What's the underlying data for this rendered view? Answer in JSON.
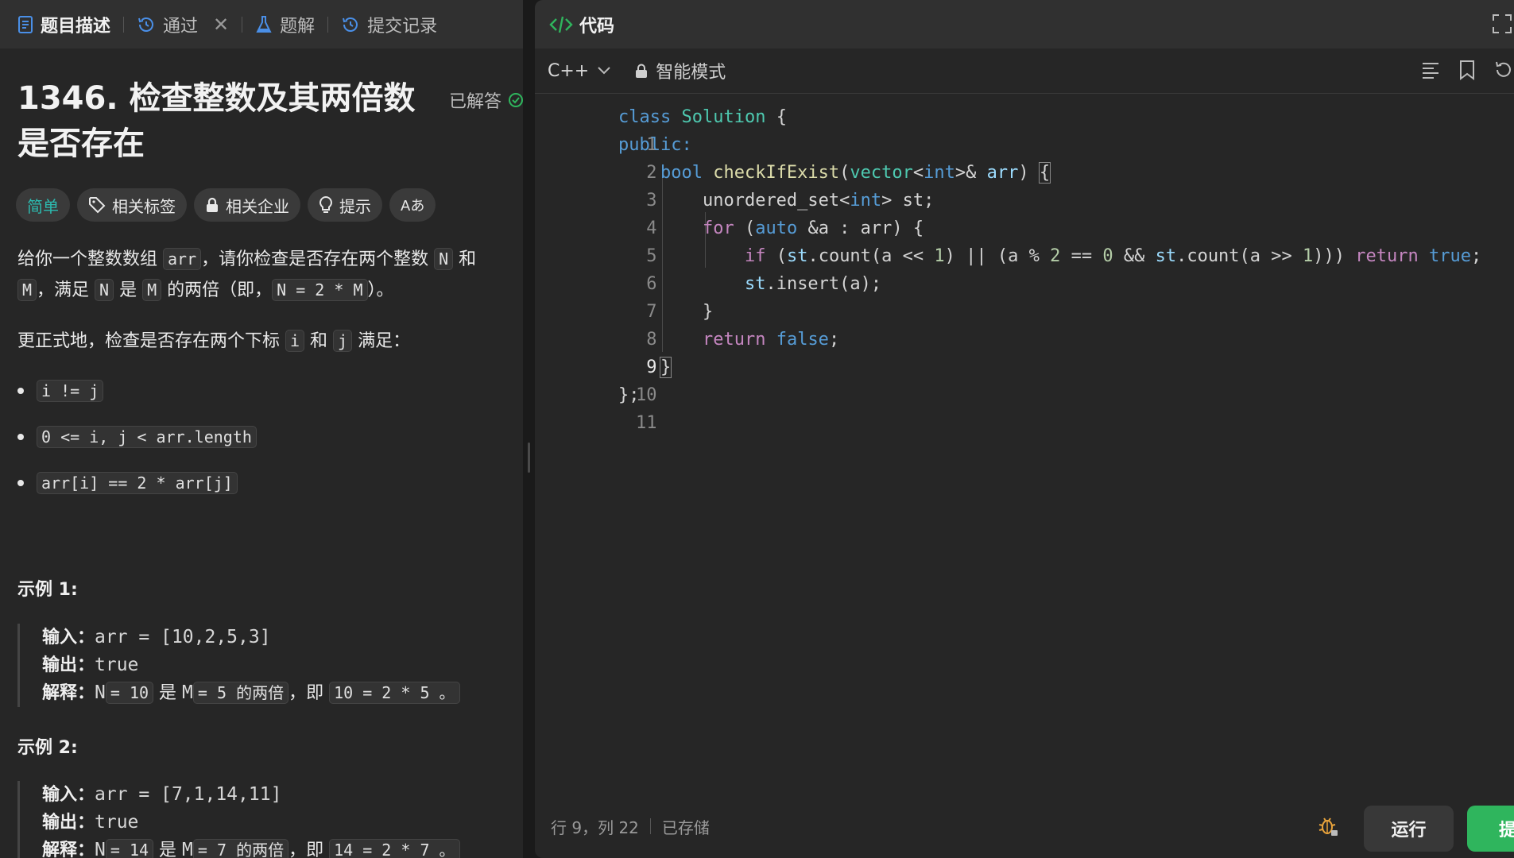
{
  "left": {
    "tabs": [
      {
        "label": "题目描述",
        "icon": "document-icon"
      },
      {
        "label": "通过",
        "icon": "history-icon"
      },
      {
        "label": "题解",
        "icon": "flask-icon"
      },
      {
        "label": "提交记录",
        "icon": "history-icon"
      }
    ],
    "title": "1346. 检查整数及其两倍数是否存在",
    "solved_label": "已解答",
    "tags": {
      "difficulty": "简单",
      "related_tags": "相关标签",
      "related_companies": "相关企业",
      "hint": "提示",
      "font": "Aあ"
    },
    "desc": {
      "p1_a": "给你一个整数数组 ",
      "p1_arr": "arr",
      "p1_b": "，请你检查是否存在两个整数 ",
      "p1_n": "N",
      "p1_c": " 和 ",
      "p1_m": "M",
      "p1_d": "，满足 ",
      "p1_n2": "N",
      "p1_e": " 是 ",
      "p1_m2": "M",
      "p1_f": " 的两倍（即，",
      "p1_eq": "N = 2 * M",
      "p1_g": "）。",
      "p2_a": "更正式地，检查是否存在两个下标 ",
      "p2_i": "i",
      "p2_b": " 和 ",
      "p2_j": "j",
      "p2_c": " 满足："
    },
    "bullets": [
      "i != j",
      "0 <= i, j < arr.length",
      "arr[i] == 2 * arr[j]"
    ],
    "examples": [
      {
        "title": "示例 1:",
        "input_label": "输入：",
        "input": "arr = [10,2,5,3]",
        "output_label": "输出：",
        "output": "true",
        "explain_label": "解释：",
        "exp_n": "N",
        "exp_nv": "= 10",
        "exp_is": " 是 ",
        "exp_m": "M",
        "exp_mv": "= 5 的两倍",
        "exp_ji": "，即 ",
        "exp_eq": "10 = 2 * 5 。"
      },
      {
        "title": "示例 2:",
        "input_label": "输入：",
        "input": "arr = [7,1,14,11]",
        "output_label": "输出：",
        "output": "true",
        "explain_label": "解释：",
        "exp_n": "N",
        "exp_nv": "= 14",
        "exp_is": " 是 ",
        "exp_m": "M",
        "exp_mv": "= 7 的两倍",
        "exp_ji": "，即 ",
        "exp_eq": "14 = 2 * 7 。"
      }
    ]
  },
  "right": {
    "header_title": "代码",
    "language": "C++",
    "mode": "智能模式",
    "line_numbers": [
      "1",
      "2",
      "3",
      "4",
      "5",
      "6",
      "7",
      "8",
      "9",
      "10",
      "11"
    ],
    "code": {
      "l1": [
        "class",
        "Solution",
        "{"
      ],
      "l2": [
        "public:"
      ],
      "l3": [
        "bool",
        "checkIfExist",
        "(",
        "vector",
        "<",
        "int",
        ">&",
        "arr",
        ")",
        "{"
      ],
      "l4": [
        "unordered_set",
        "<",
        "int",
        ">",
        " st;"
      ],
      "l5": [
        "for",
        " (",
        "auto",
        " &a : arr) {"
      ],
      "l6": [
        "if",
        " (",
        "st",
        ".count(a << ",
        "1",
        ") || (a % ",
        "2",
        " == ",
        "0",
        " && ",
        "st",
        ".count(a >> ",
        "1",
        "))) ",
        "return",
        " ",
        "true",
        ";"
      ],
      "l7": [
        "st",
        ".insert(a);"
      ],
      "l8": [
        "}"
      ],
      "l9": [
        "return",
        " ",
        "false",
        ";"
      ],
      "l10": [
        "}"
      ],
      "l11": [
        "};"
      ]
    },
    "status": {
      "position": "行 9，列 22",
      "saved": "已存储"
    },
    "run_label": "运行",
    "submit_label": "提交"
  },
  "colors": {
    "accent_green": "#2fb55d",
    "easy_teal": "#2cbbb0",
    "keyword": "#569cd6",
    "class_name": "#4ec9b0",
    "function": "#dcdcaa",
    "control": "#c586c0",
    "number": "#b5cea8"
  }
}
